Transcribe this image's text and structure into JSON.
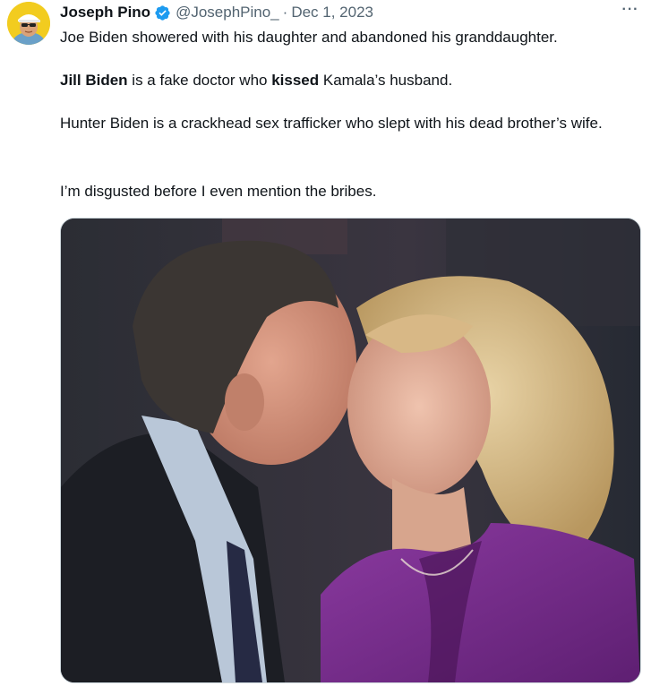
{
  "author": {
    "name": "Joseph Pino",
    "handle": "@JosephPino_",
    "date": "Dec 1, 2023",
    "avatar_icon": "avatar-image",
    "verified_icon": "verified-badge-icon"
  },
  "more_label": "···",
  "text": {
    "line1": "Joe Biden showered with his daughter and abandoned his granddaughter.",
    "line2_bold_a": "Jill Biden",
    "line2_mid": " is a fake doctor who ",
    "line2_bold_b": "kissed",
    "line2_end": " Kamala’s husband.",
    "line3": "Hunter Biden is a crackhead sex trafficker who slept with his dead brother’s wife.",
    "line4": "I’m disgusted before I even mention the bribes."
  },
  "colors": {
    "verified": "#1d9bf0",
    "muted": "#536471",
    "text": "#0f1419",
    "avatar_bg": "#f2cc1f"
  }
}
